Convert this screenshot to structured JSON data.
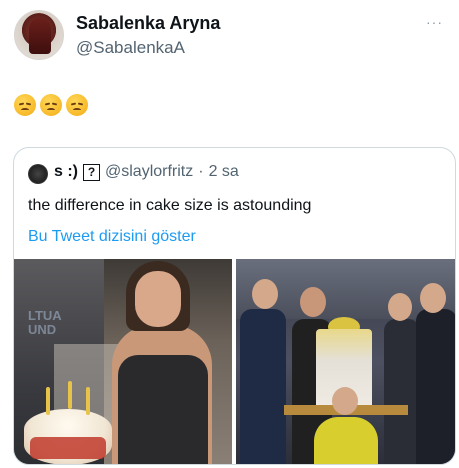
{
  "tweet": {
    "author_name": "Sabalenka Aryna",
    "author_handle": "@SabalenkaA",
    "more_label": "···",
    "body_emoji": [
      "😞",
      "😞",
      "😞"
    ]
  },
  "quoted": {
    "name": "s :)",
    "badge": "?",
    "handle": "@slaylorfritz",
    "separator": "·",
    "time": "2 sa",
    "text": "the difference in cake size is astounding",
    "show_thread_label": "Bu Tweet dizisini göster"
  },
  "photos": {
    "left_sign": "LTUA\nUND"
  }
}
